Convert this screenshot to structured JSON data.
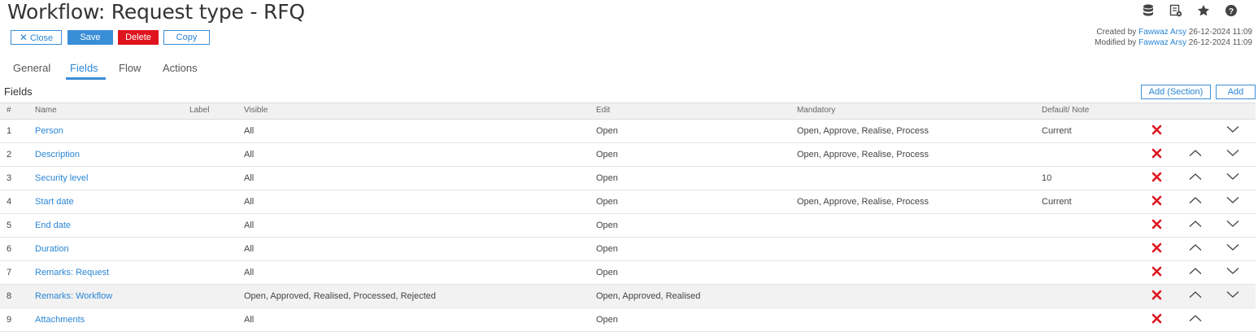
{
  "header": {
    "title": "Workflow: Request type - RFQ",
    "buttons": {
      "close": "Close",
      "save": "Save",
      "delete": "Delete",
      "copy": "Copy"
    },
    "icons": [
      "database-icon",
      "report-icon",
      "star-icon",
      "help-icon"
    ],
    "meta": {
      "created_prefix": "Created by",
      "created_user": "Fawwaz Arsy",
      "created_date": "26-12-2024 11:09",
      "modified_prefix": "Modified by",
      "modified_user": "Fawwaz Arsy",
      "modified_date": "26-12-2024 11:09"
    }
  },
  "tabs": [
    {
      "label": "General"
    },
    {
      "label": "Fields",
      "active": true
    },
    {
      "label": "Flow"
    },
    {
      "label": "Actions"
    }
  ],
  "fields": {
    "title": "Fields",
    "add_section_label": "Add (Section)",
    "add_label": "Add",
    "columns": [
      "#",
      "Name",
      "Label",
      "Visible",
      "Edit",
      "Mandatory",
      "Default/ Note"
    ],
    "rows": [
      {
        "num": "1",
        "name": "Person",
        "label": "",
        "visible": "All",
        "edit": "Open",
        "mandatory": "Open, Approve, Realise, Process",
        "default": "Current",
        "up": false,
        "down": true
      },
      {
        "num": "2",
        "name": "Description",
        "label": "",
        "visible": "All",
        "edit": "Open",
        "mandatory": "Open, Approve, Realise, Process",
        "default": "",
        "up": true,
        "down": true
      },
      {
        "num": "3",
        "name": "Security level",
        "label": "",
        "visible": "All",
        "edit": "Open",
        "mandatory": "",
        "default": "10",
        "up": true,
        "down": true
      },
      {
        "num": "4",
        "name": "Start date",
        "label": "",
        "visible": "All",
        "edit": "Open",
        "mandatory": "Open, Approve, Realise, Process",
        "default": "Current",
        "up": true,
        "down": true
      },
      {
        "num": "5",
        "name": "End date",
        "label": "",
        "visible": "All",
        "edit": "Open",
        "mandatory": "",
        "default": "",
        "up": true,
        "down": true
      },
      {
        "num": "6",
        "name": "Duration",
        "label": "",
        "visible": "All",
        "edit": "Open",
        "mandatory": "",
        "default": "",
        "up": true,
        "down": true
      },
      {
        "num": "7",
        "name": "Remarks: Request",
        "label": "",
        "visible": "All",
        "edit": "Open",
        "mandatory": "",
        "default": "",
        "up": true,
        "down": true
      },
      {
        "num": "8",
        "name": "Remarks: Workflow",
        "label": "",
        "visible": "Open, Approved, Realised, Processed, Rejected",
        "edit": "Open, Approved, Realised",
        "mandatory": "",
        "default": "",
        "up": true,
        "down": true,
        "highlighted": true
      },
      {
        "num": "9",
        "name": "Attachments",
        "label": "",
        "visible": "All",
        "edit": "Open",
        "mandatory": "",
        "default": "",
        "up": true,
        "down": false
      }
    ]
  },
  "colors": {
    "accent": "#3a8ed8",
    "link": "#2a86d6",
    "delete": "#e0141e"
  }
}
